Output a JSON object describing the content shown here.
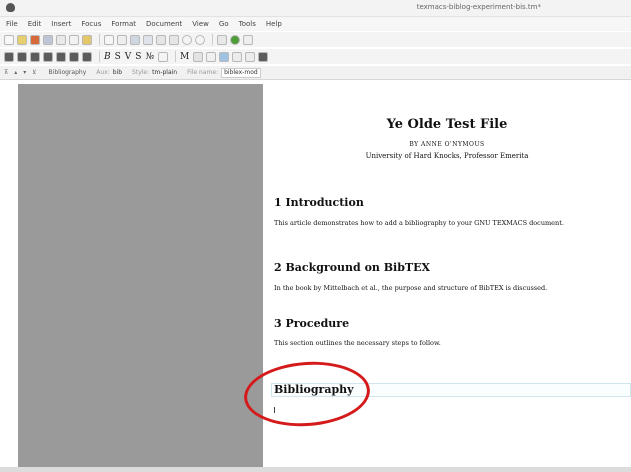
{
  "window": {
    "title": "texmacs-biblog-experiment-bis.tm*"
  },
  "menu": [
    "File",
    "Edit",
    "Insert",
    "Focus",
    "Format",
    "Document",
    "View",
    "Go",
    "Tools",
    "Help"
  ],
  "format_toolbar": {
    "bold": "B",
    "sans": "S",
    "vector": "V",
    "small_caps": "S",
    "no": "№",
    "math": "M"
  },
  "focus_bar": {
    "arrows": "⊼ ▴ ▾ ⊻",
    "context": "Bibliography",
    "aux_label": "Aux:",
    "aux_value": "bib",
    "style_label": "Style:",
    "style_value": "tm-plain",
    "file_label": "File name:",
    "file_value": "biblex-mod"
  },
  "document": {
    "title": "Ye Olde Test File",
    "author": "BY ANNE O'NYMOUS",
    "affiliation": "University of Hard Knocks, Professor Emerita",
    "sections": [
      {
        "heading": "1  Introduction",
        "body": "This article demonstrates how to add a bibliography to your GNU TEXMACS document."
      },
      {
        "heading": "2  Background on BibTEX",
        "body": "In the book by Mittelbach et al., the purpose and structure of BibTEX is discussed."
      },
      {
        "heading": "3  Procedure",
        "body": "This section outlines the necessary steps to follow."
      }
    ],
    "bibliography_heading": "Bibliography"
  },
  "colors": {
    "annotation": "#d41a1a",
    "workspace": "#9a9a9a"
  }
}
